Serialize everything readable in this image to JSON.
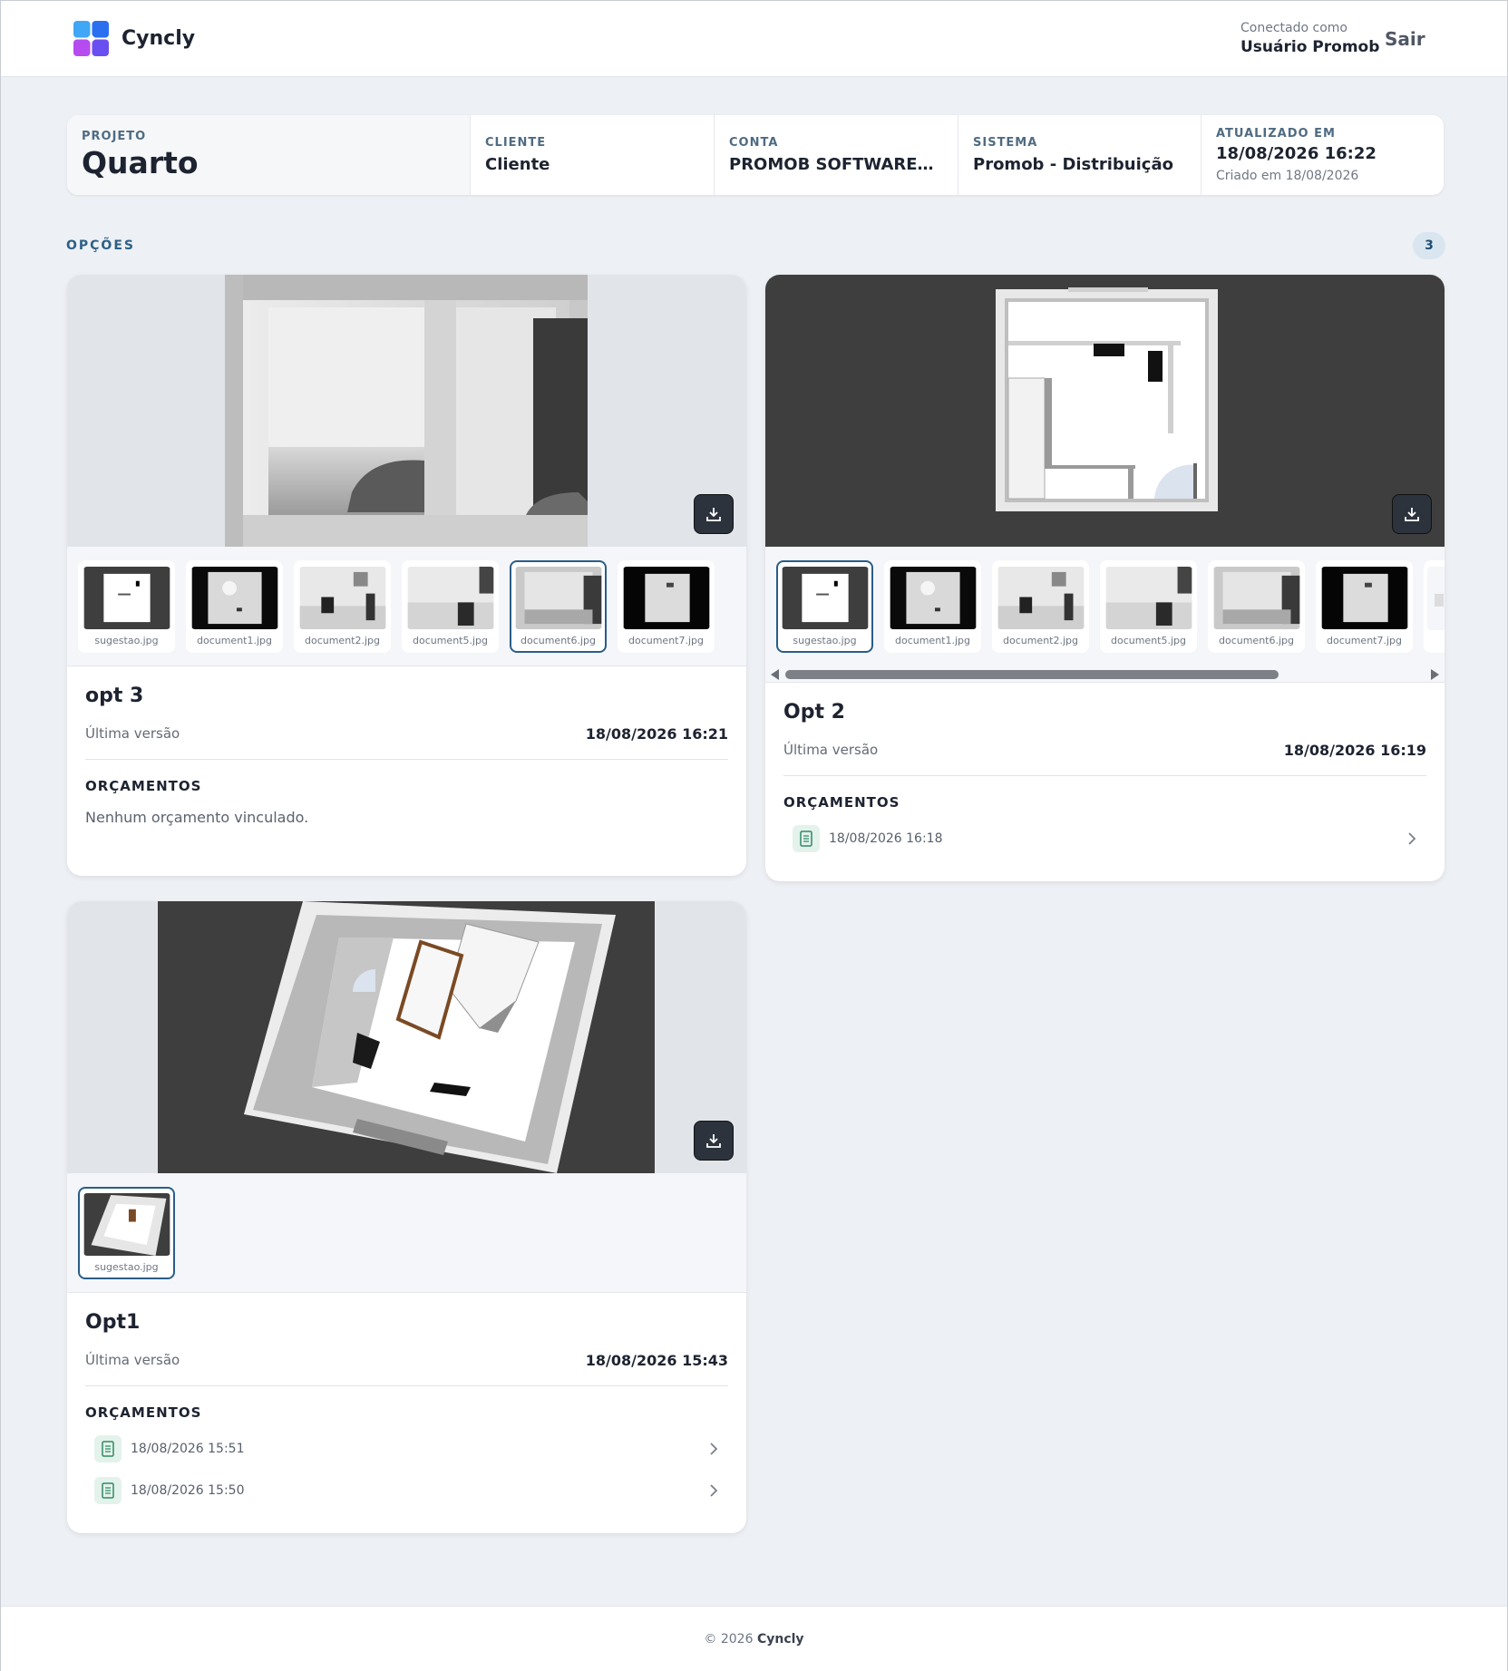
{
  "header": {
    "brand": "Cyncly",
    "connected_caption": "Conectado como",
    "user_name": "Usuário Promob",
    "logout_label": "Sair"
  },
  "project": {
    "project_label": "PROJETO",
    "project_name": "Quarto",
    "client_label": "CLIENTE",
    "client_value": "Cliente",
    "account_label": "CONTA",
    "account_value": "PROMOB SOFTWARES S....",
    "system_label": "SISTEMA",
    "system_value": "Promob - Distribuição",
    "updated_label": "ATUALIZADO EM",
    "updated_value": "18/08/2026 16:22",
    "created_text": "Criado em 18/08/2026"
  },
  "options_section": {
    "title": "OPÇÕES",
    "count": "3"
  },
  "cards": [
    {
      "title": "opt 3",
      "last_version_label": "Última versão",
      "last_version_value": "18/08/2026 16:21",
      "budgets_title": "ORÇAMENTOS",
      "empty_message": "Nenhum orçamento vinculado.",
      "thumbs": [
        "sugestao.jpg",
        "document1.jpg",
        "document2.jpg",
        "document5.jpg",
        "document6.jpg",
        "document7.jpg"
      ],
      "active_thumb": "document6.jpg"
    },
    {
      "title": "Opt 2",
      "last_version_label": "Última versão",
      "last_version_value": "18/08/2026 16:19",
      "budgets_title": "ORÇAMENTOS",
      "budgets": [
        "18/08/2026 16:18"
      ],
      "thumbs": [
        "sugestao.jpg",
        "document1.jpg",
        "document2.jpg",
        "document5.jpg",
        "document6.jpg",
        "document7.jpg"
      ],
      "active_thumb": "sugestao.jpg"
    },
    {
      "title": "Opt1",
      "last_version_label": "Última versão",
      "last_version_value": "18/08/2026 15:43",
      "budgets_title": "ORÇAMENTOS",
      "budgets": [
        "18/08/2026 15:51",
        "18/08/2026 15:50"
      ],
      "thumbs": [
        "sugestao.jpg"
      ],
      "active_thumb": "sugestao.jpg"
    }
  ],
  "footer": {
    "copyright": "© 2026",
    "brand": "Cyncly"
  },
  "icons": {
    "download": "download-icon",
    "document": "document-icon",
    "chevron": "chevron-right-icon"
  },
  "colors": {
    "accent": "#2a5d87",
    "budget_icon_bg": "#e4f2ec",
    "budget_icon_fg": "#2f8a64"
  }
}
